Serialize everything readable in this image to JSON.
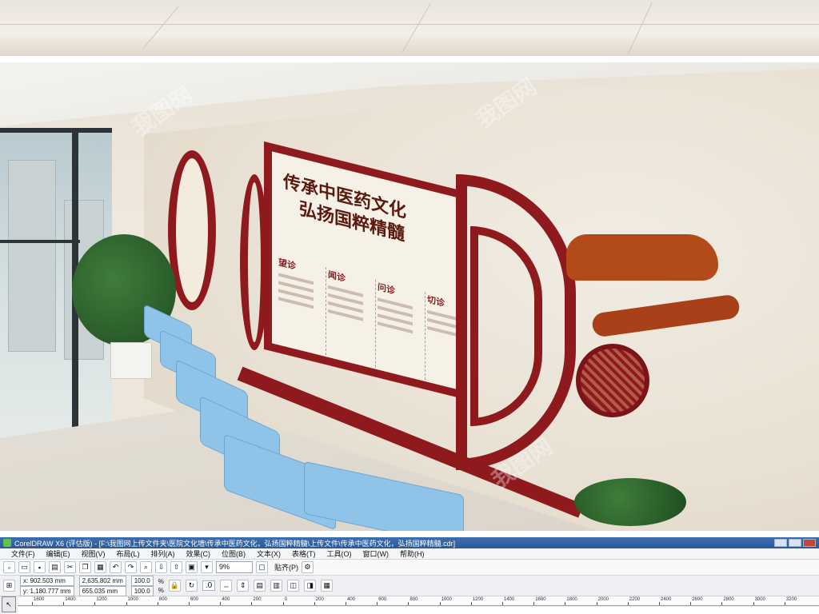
{
  "scene": {
    "panel_title_line1": "传承中医药文化",
    "panel_title_line2": "弘扬国粹精髓",
    "columns": [
      "望诊",
      "闻诊",
      "问诊",
      "切诊"
    ],
    "watermark_text": "我图网",
    "colors": {
      "frame_red": "#8e1a1e",
      "cloud_orange": "#b34a1a",
      "chair_blue": "#8fc4e8",
      "wall": "#ece5d9"
    }
  },
  "app": {
    "title": "CorelDRAW X6 (评估版) - [F:\\我图网上传文件夹\\医院文化墙\\传承中医药文化，弘扬国粹精髓\\上传文件\\传承中医药文化，弘扬国粹精髓.cdr]",
    "menu": [
      "文件(F)",
      "编辑(E)",
      "视图(V)",
      "布局(L)",
      "排列(A)",
      "效果(C)",
      "位图(B)",
      "文本(X)",
      "表格(T)",
      "工具(O)",
      "窗口(W)",
      "帮助(H)"
    ],
    "zoom": "9%",
    "snap_label": "贴齐(P)",
    "x_coord": "x: 902.503 mm",
    "y_coord": "y: 1,180.777 mm",
    "width": "2,635.802 mm",
    "height": "655.035 mm",
    "scale_w": "100.0",
    "scale_h": "100.0",
    "percent": "%",
    "angle": ".0",
    "ruler_labels": [
      "1600",
      "1400",
      "1200",
      "1000",
      "800",
      "600",
      "400",
      "200",
      "0",
      "200",
      "400",
      "600",
      "800",
      "1000",
      "1200",
      "1400",
      "1600",
      "1800",
      "2000",
      "2200",
      "2400",
      "2600",
      "2800",
      "3000",
      "3200"
    ]
  }
}
